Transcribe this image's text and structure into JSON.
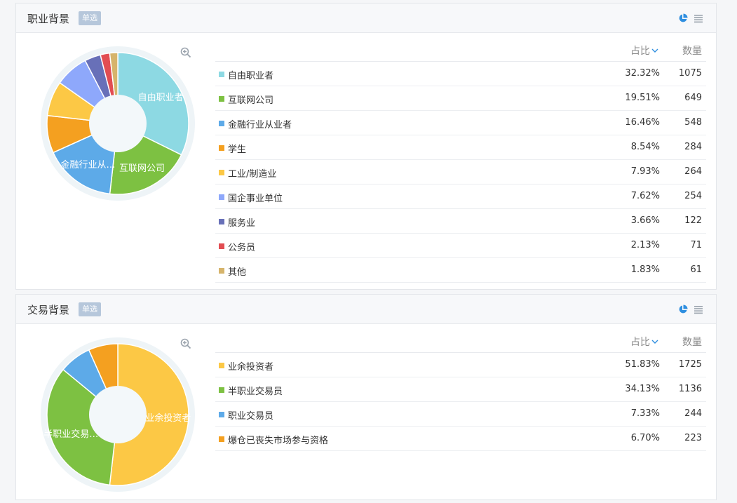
{
  "panels": [
    {
      "title": "职业背景",
      "badge": "单选",
      "header_pct": "占比",
      "header_count": "数量",
      "chart_data": {
        "type": "pie",
        "categories": [
          "自由职业者",
          "互联网公司",
          "金融行业从业者",
          "学生",
          "工业/制造业",
          "国企事业单位",
          "服务业",
          "公务员",
          "其他"
        ],
        "values": [
          1075,
          649,
          548,
          284,
          264,
          254,
          122,
          71,
          61
        ],
        "percents": [
          "32.32%",
          "19.51%",
          "16.46%",
          "8.54%",
          "7.93%",
          "7.62%",
          "3.66%",
          "2.13%",
          "1.83%"
        ],
        "counts": [
          "1075",
          "649",
          "548",
          "284",
          "264",
          "254",
          "122",
          "71",
          "61"
        ],
        "colors": [
          "#8dd9e3",
          "#7dc142",
          "#5daae8",
          "#f4a020",
          "#fcc845",
          "#8ea8fb",
          "#6870b8",
          "#e24d52",
          "#d6b46b"
        ],
        "slice_labels": [
          "自由职业者",
          "互联网公司",
          "金融行业从…",
          "",
          "",
          "",
          "",
          "",
          ""
        ],
        "title": "",
        "legend": "table-right"
      }
    },
    {
      "title": "交易背景",
      "badge": "单选",
      "header_pct": "占比",
      "header_count": "数量",
      "chart_data": {
        "type": "pie",
        "categories": [
          "业余投资者",
          "半职业交易员",
          "职业交易员",
          "爆仓已丧失市场参与资格"
        ],
        "values": [
          1725,
          1136,
          244,
          223
        ],
        "percents": [
          "51.83%",
          "34.13%",
          "7.33%",
          "6.70%"
        ],
        "counts": [
          "1725",
          "1136",
          "244",
          "223"
        ],
        "colors": [
          "#fcc845",
          "#7dc142",
          "#5daae8",
          "#f4a020"
        ],
        "slice_labels": [
          "业余投资者",
          "半职业交易…",
          "",
          ""
        ],
        "title": "",
        "legend": "table-right"
      }
    }
  ]
}
